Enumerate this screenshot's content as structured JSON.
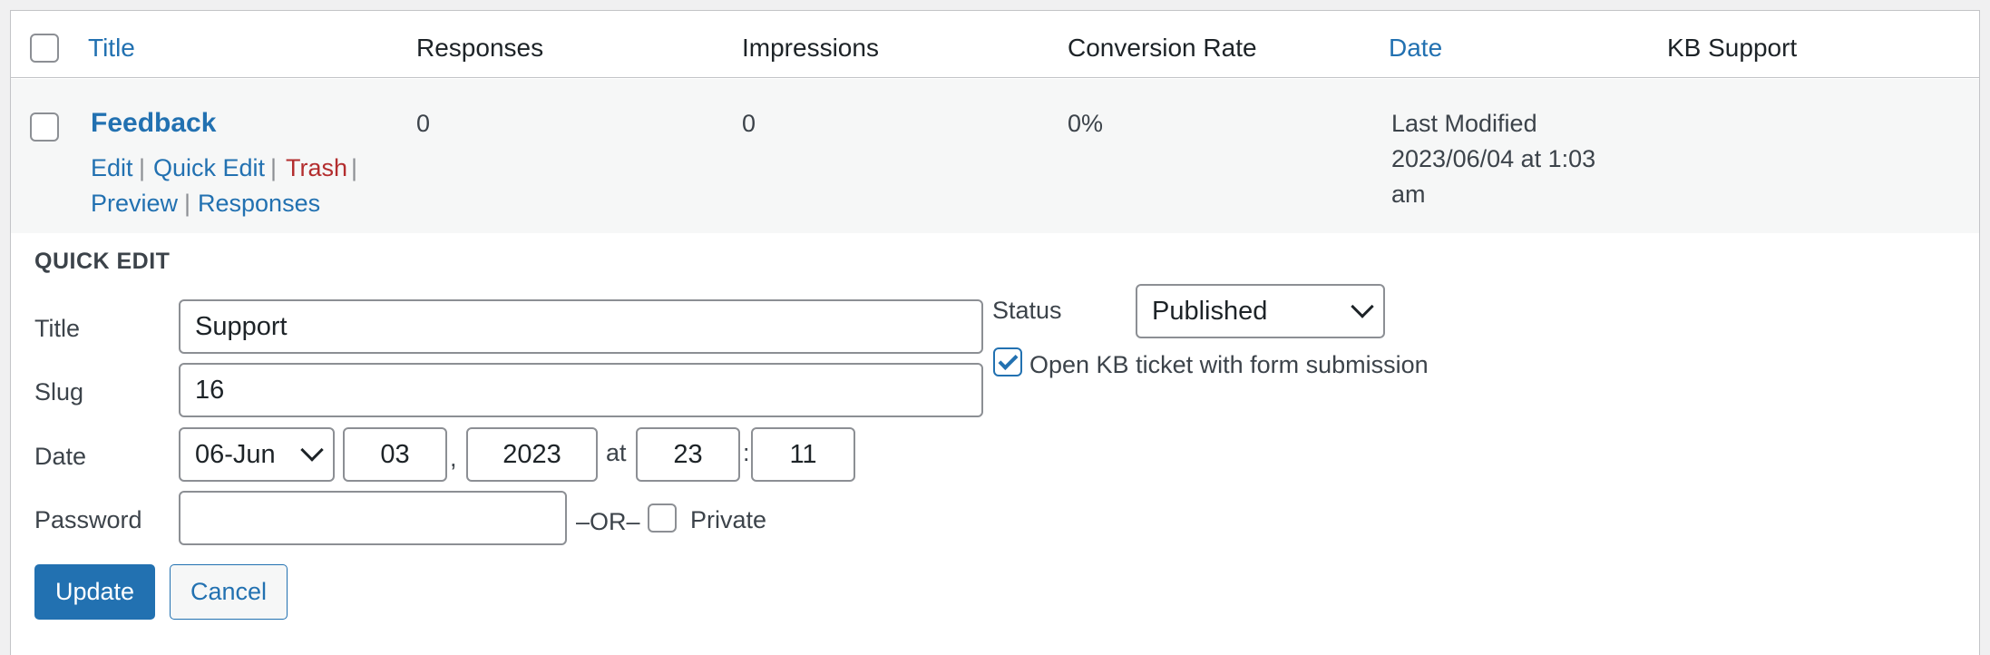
{
  "table": {
    "columns": {
      "title": "Title",
      "responses": "Responses",
      "impressions": "Impressions",
      "conversion_rate": "Conversion Rate",
      "date": "Date",
      "kb_support": "KB Support"
    },
    "row": {
      "title": "Feedback",
      "actions": {
        "edit": "Edit",
        "quick_edit": "Quick Edit",
        "trash": "Trash",
        "preview": "Preview",
        "responses": "Responses"
      },
      "separator": "|",
      "responses": "0",
      "impressions": "0",
      "conversion_rate": "0%",
      "date_line1": "Last Modified",
      "date_line2": "2023/06/04 at 1:03",
      "date_line3": "am"
    }
  },
  "quick_edit": {
    "heading": "QUICK EDIT",
    "labels": {
      "title": "Title",
      "slug": "Slug",
      "date": "Date",
      "password": "Password",
      "status": "Status"
    },
    "values": {
      "title": "Support",
      "slug": "16",
      "month": "06-Jun",
      "day": "03",
      "year": "2023",
      "hour": "23",
      "minute": "11",
      "password": "",
      "status": "Published"
    },
    "punct": {
      "comma": ",",
      "at": "at",
      "colon": ":",
      "or": "–OR–"
    },
    "private_label": "Private",
    "private_checked": false,
    "kb_ticket_label": "Open KB ticket with form submission",
    "kb_ticket_checked": true,
    "buttons": {
      "update": "Update",
      "cancel": "Cancel"
    }
  },
  "colors": {
    "link": "#2271b1",
    "trash": "#b32d2e",
    "primary_button": "#2271b1",
    "row_background": "#f6f7f7"
  }
}
